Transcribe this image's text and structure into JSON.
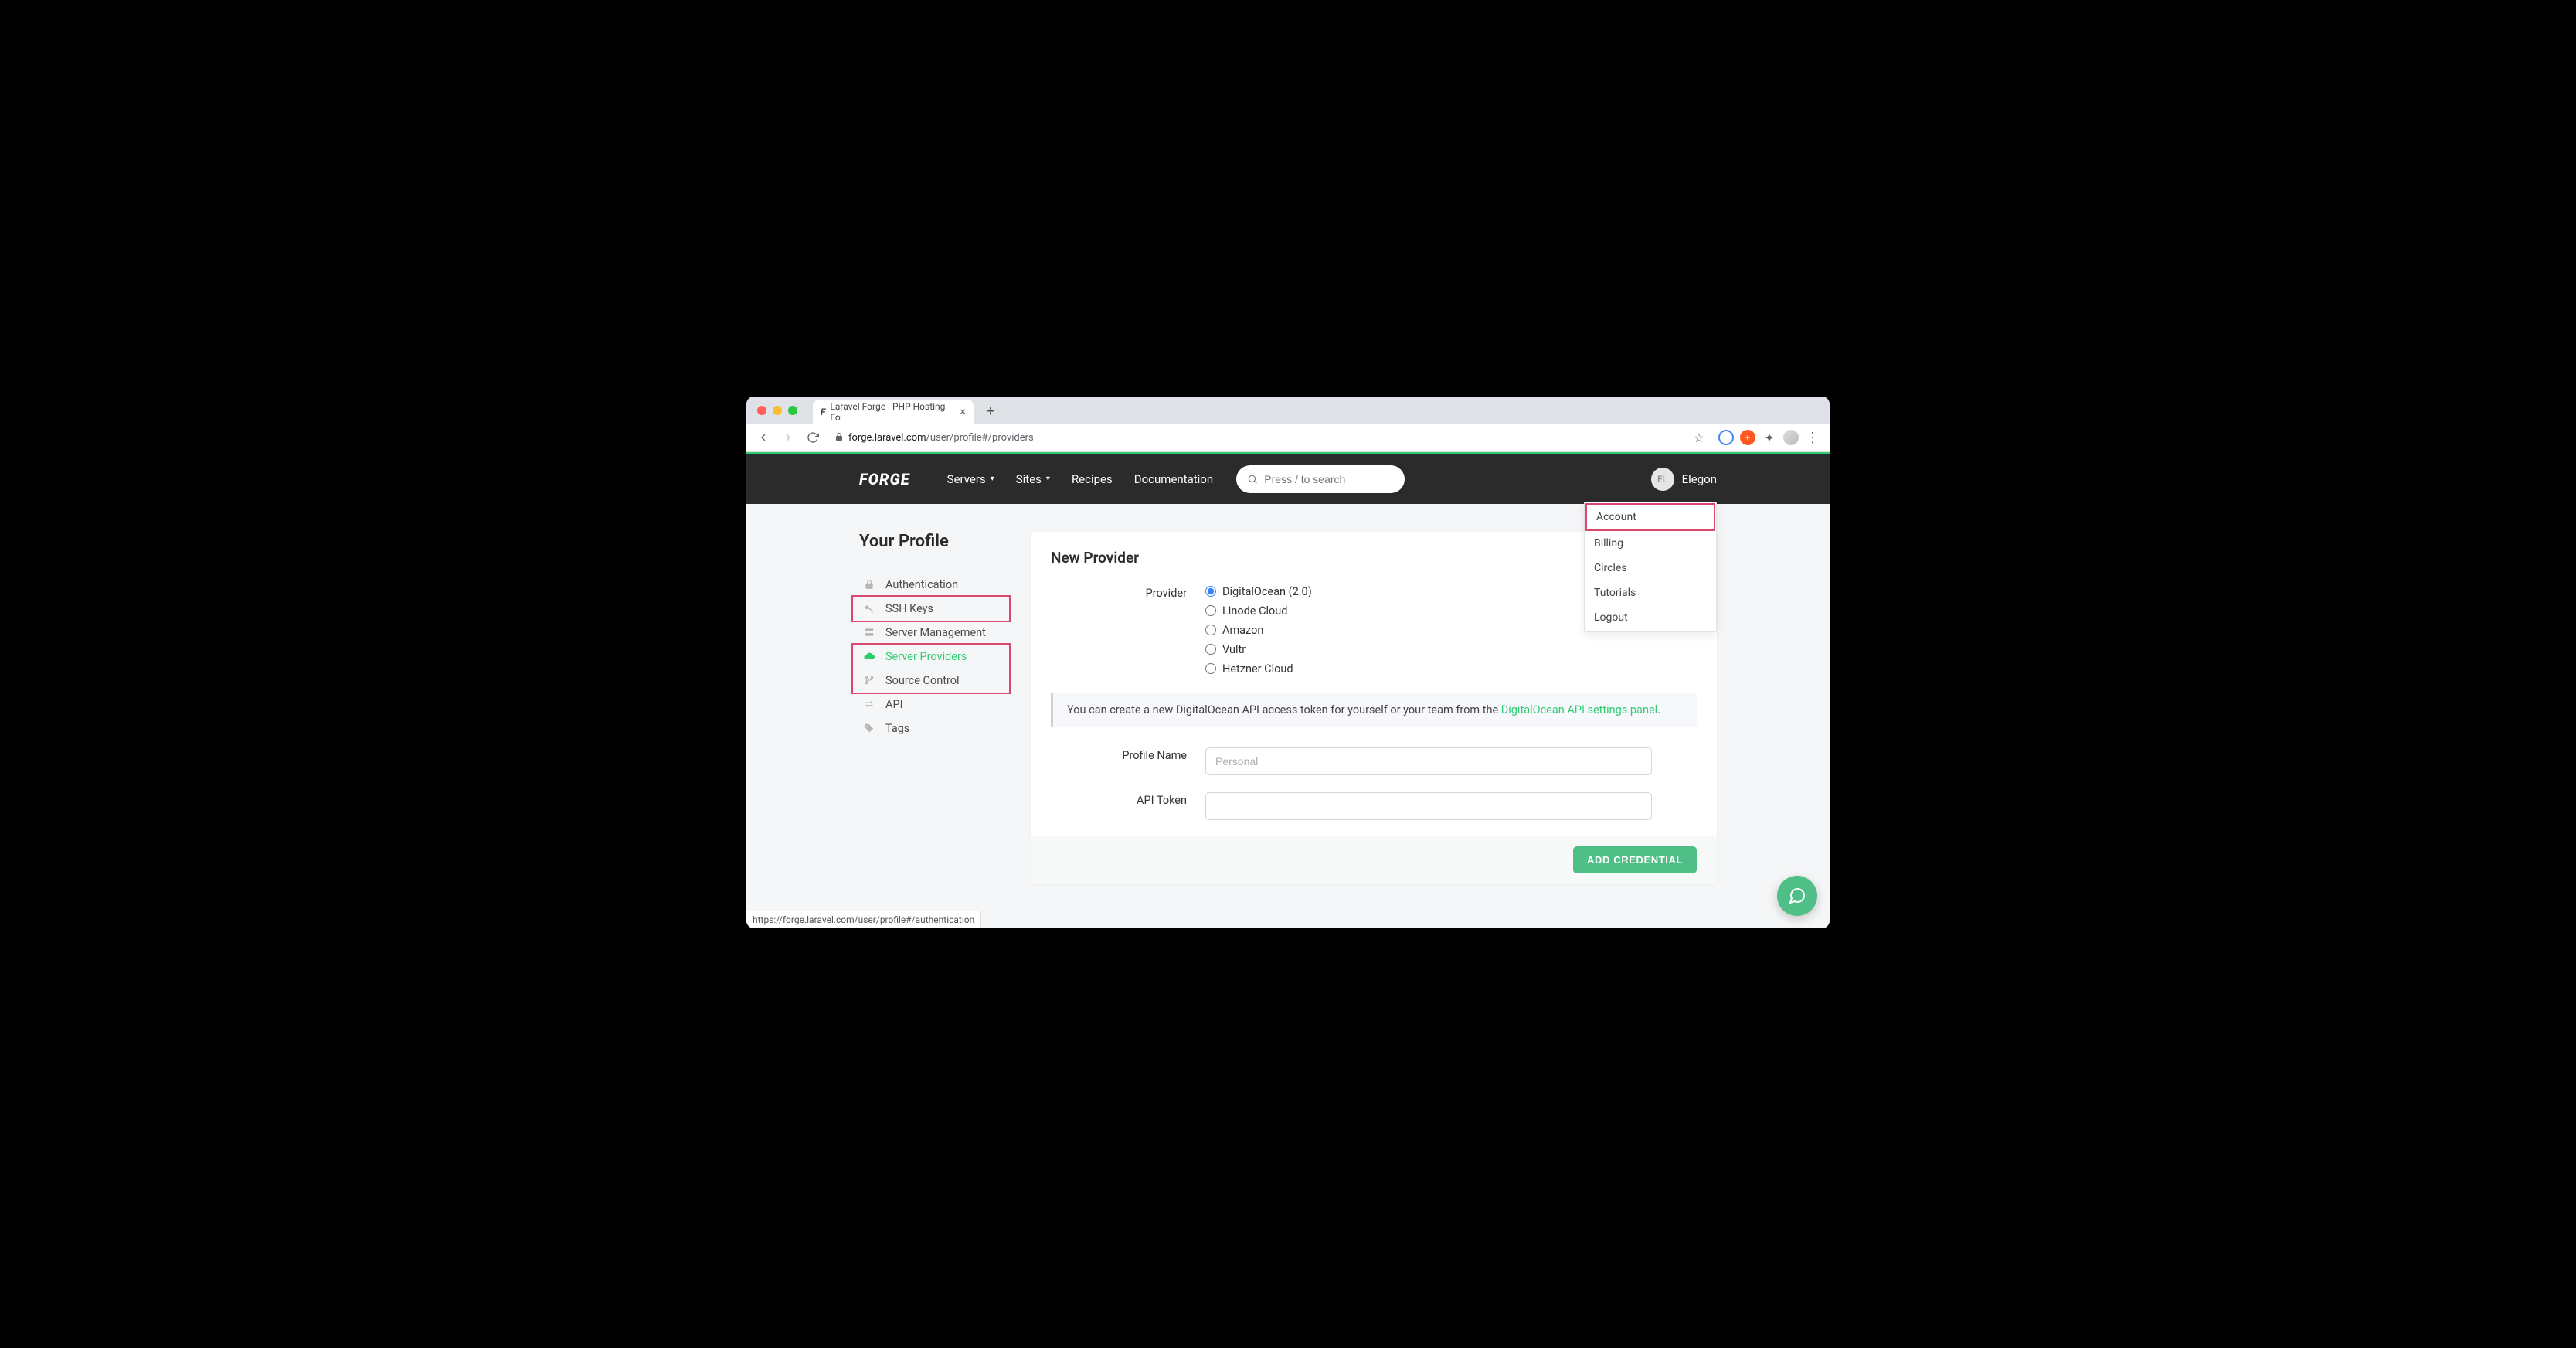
{
  "browser": {
    "tab_title": "Laravel Forge | PHP Hosting Fo",
    "url_host": "forge.laravel.com",
    "url_path": "/user/profile#/providers",
    "status_url": "https://forge.laravel.com/user/profile#/authentication"
  },
  "header": {
    "logo": "FORGE",
    "nav": {
      "servers": "Servers",
      "sites": "Sites",
      "recipes": "Recipes",
      "documentation": "Documentation"
    },
    "search_placeholder": "Press / to search",
    "user": {
      "initials": "EL",
      "name": "Elegon"
    },
    "dropdown": {
      "account": "Account",
      "billing": "Billing",
      "circles": "Circles",
      "tutorials": "Tutorials",
      "logout": "Logout"
    }
  },
  "sidebar": {
    "title": "Your Profile",
    "items": {
      "authentication": "Authentication",
      "ssh_keys": "SSH Keys",
      "server_management": "Server Management",
      "server_providers": "Server Providers",
      "source_control": "Source Control",
      "api": "API",
      "tags": "Tags"
    }
  },
  "card": {
    "title": "New Provider",
    "provider_label": "Provider",
    "providers": {
      "digitalocean": "DigitalOcean (2.0)",
      "linode": "Linode Cloud",
      "amazon": "Amazon",
      "vultr": "Vultr",
      "hetzner": "Hetzner Cloud"
    },
    "hint_prefix": "You can create a new DigitalOcean API access token for yourself or your team from the ",
    "hint_link": "DigitalOcean API settings panel",
    "hint_suffix": ".",
    "profile_name_label": "Profile Name",
    "profile_name_placeholder": "Personal",
    "api_token_label": "API Token",
    "submit": "ADD CREDENTIAL"
  }
}
